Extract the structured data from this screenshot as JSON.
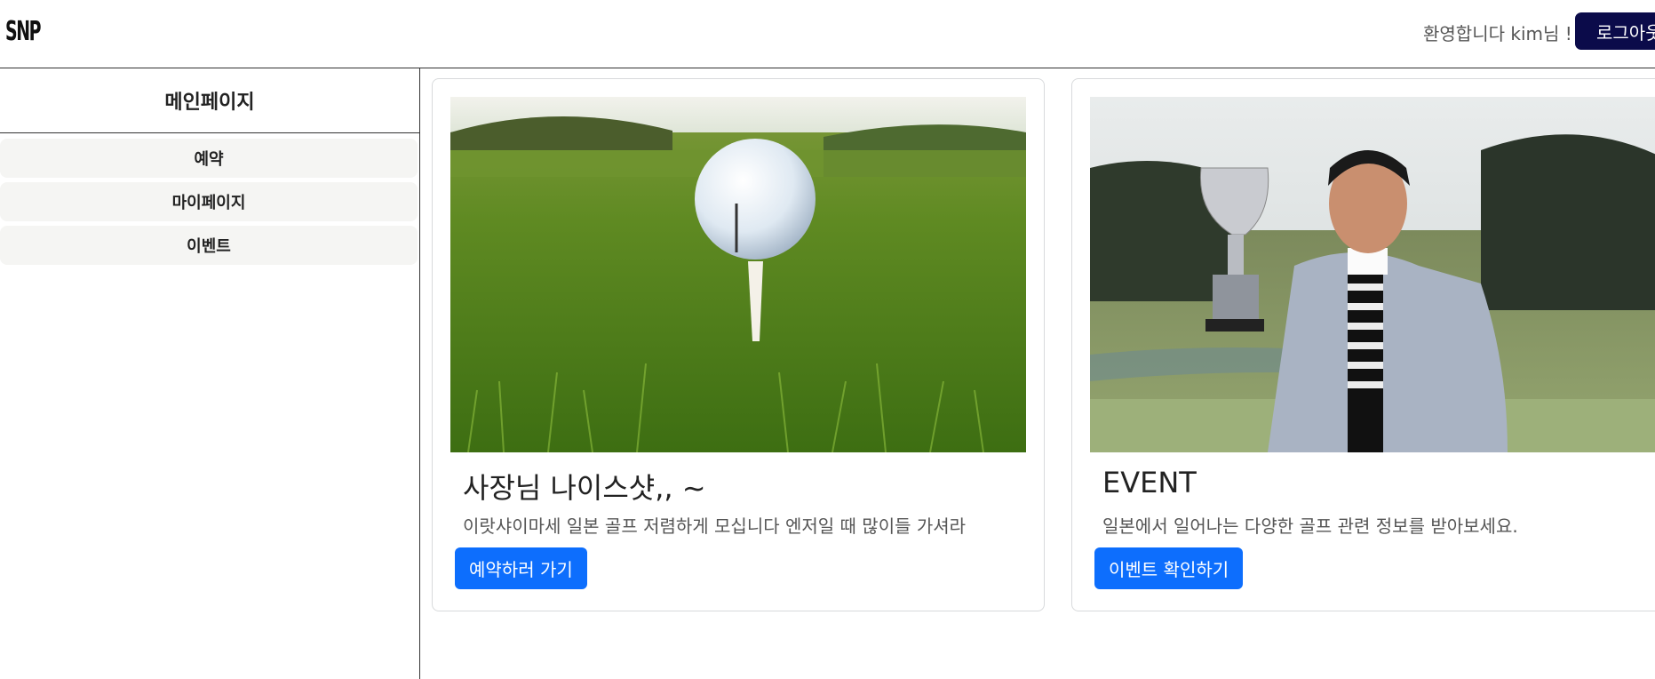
{
  "header": {
    "logo": "SNP",
    "welcome": "환영합니다 kim님 !",
    "logout_label": "로그아웃"
  },
  "sidebar": {
    "title": "메인페이지",
    "items": [
      {
        "label": "예약"
      },
      {
        "label": "마이페이지"
      },
      {
        "label": "이벤트"
      }
    ]
  },
  "cards": [
    {
      "title": "사장님 나이스샷,, ~",
      "text": "이랏샤이마세 일본 골프 저렴하게 모십니다 엔저일 때 많이들 가셔라",
      "button": "예약하러 가기",
      "image": "golf-ball-on-tee-photo"
    },
    {
      "title": "EVENT",
      "text": "일본에서 일어나는 다양한 골프 관련 정보를 받아보세요.",
      "button": "이벤트 확인하기",
      "image": "man-holding-trophy-photo"
    }
  ],
  "colors": {
    "primary_button": "#0d6efd",
    "logout_button": "#0b0b4a",
    "sidebar_item_bg": "#f5f5f3"
  }
}
